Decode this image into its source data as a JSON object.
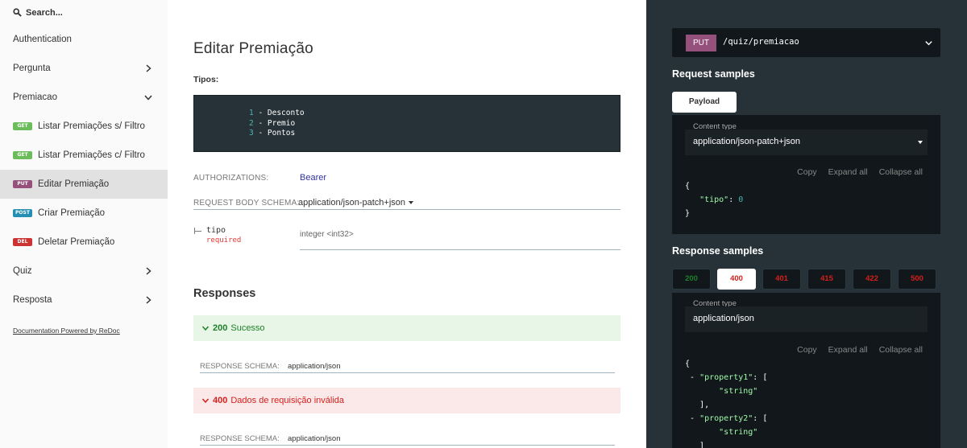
{
  "sidebar": {
    "search_placeholder": "Search...",
    "items": [
      {
        "label": "Authentication"
      },
      {
        "label": "Pergunta"
      },
      {
        "label": "Premiacao"
      },
      {
        "label": "Listar Premiações s/ Filtro",
        "method": "GET"
      },
      {
        "label": "Listar Premiações c/ Filtro",
        "method": "GET"
      },
      {
        "label": "Editar Premiação",
        "method": "PUT"
      },
      {
        "label": "Criar Premiação",
        "method": "POST"
      },
      {
        "label": "Deletar Premiação",
        "method": "DEL"
      },
      {
        "label": "Quiz"
      },
      {
        "label": "Resposta"
      }
    ],
    "powered_by": "Documentation Powered by ReDoc"
  },
  "main": {
    "title": "Editar Premiação",
    "tipos_label": "Tipos:",
    "code_lines": [
      {
        "num": "1",
        "text": " - Desconto"
      },
      {
        "num": "2",
        "text": " - Premio"
      },
      {
        "num": "3",
        "text": " - Pontos"
      }
    ],
    "authorizations_label": "AUTHORIZATIONS:",
    "authorizations_value": "Bearer",
    "request_body_label": "REQUEST BODY SCHEMA:",
    "request_body_value": "application/json-patch+json",
    "property": {
      "name": "tipo",
      "required": "required",
      "type": "integer <int32>"
    },
    "responses_title": "Responses",
    "responses": [
      {
        "code": "200",
        "text": "Sucesso",
        "schema_label": "RESPONSE SCHEMA:",
        "schema_value": "application/json"
      },
      {
        "code": "400",
        "text": "Dados de requisição inválida",
        "schema_label": "RESPONSE SCHEMA:",
        "schema_value": "application/json"
      }
    ]
  },
  "right": {
    "method": "PUT",
    "path": "/quiz/premiacao",
    "request_samples_title": "Request samples",
    "payload_tab": "Payload",
    "request_content_type_label": "Content type",
    "request_content_type": "application/json-patch+json",
    "tools": {
      "copy": "Copy",
      "expand": "Expand all",
      "collapse": "Collapse all"
    },
    "request_json": {
      "open": "{",
      "key": "\"tipo\"",
      "colon": ": ",
      "value": "0",
      "close": "}"
    },
    "response_samples_title": "Response samples",
    "response_tabs": [
      "200",
      "400",
      "401",
      "415",
      "422",
      "500"
    ],
    "response_content_type_label": "Content type",
    "response_content_type": "application/json",
    "response_json": {
      "open": "{",
      "p1": "\"property1\"",
      "p2": "\"property2\"",
      "s": "\"string\"",
      "close_arr": "],"
    }
  },
  "colors": {
    "get": "#6bbd5b",
    "put": "#95507c",
    "post": "#248fb2",
    "del": "#cc3333",
    "success": "#1d8127",
    "error": "#d41f1c",
    "panel": "#263238"
  }
}
